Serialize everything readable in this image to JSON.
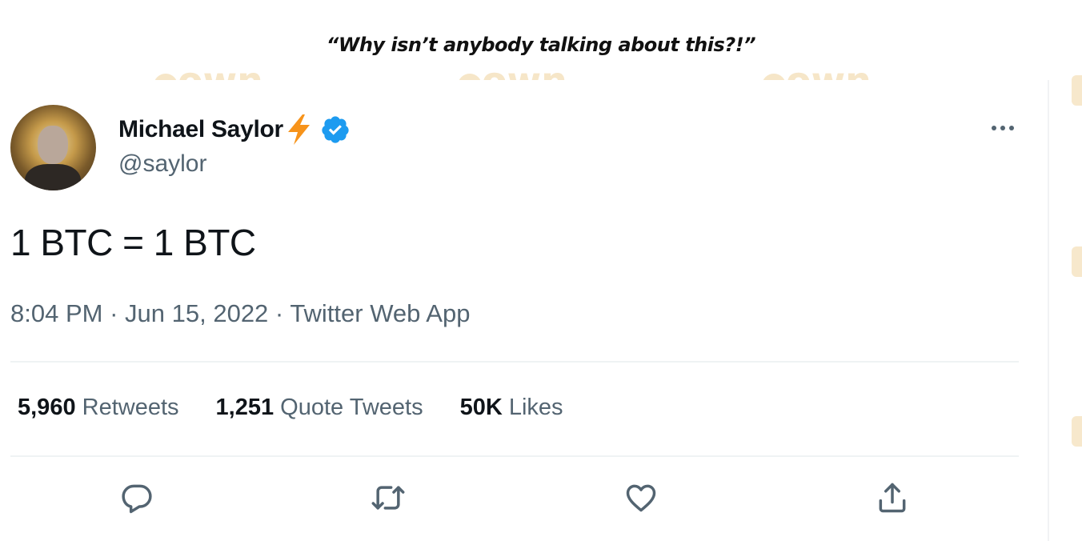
{
  "caption": "“Why isn’t anybody talking about this?!”",
  "watermark": {
    "text": "own",
    "color": "#f6e6c8"
  },
  "tweet": {
    "author_name": "Michael Saylor",
    "author_emoji": "⚡",
    "verified": true,
    "handle": "@saylor",
    "text": "1 BTC = 1 BTC",
    "time": "8:04 PM",
    "date": "Jun 15, 2022",
    "separator": "·",
    "source": "Twitter Web App",
    "stats": [
      {
        "value": "5,960",
        "label": "Retweets"
      },
      {
        "value": "1,251",
        "label": "Quote Tweets"
      },
      {
        "value": "50K",
        "label": "Likes"
      }
    ],
    "actions": [
      "reply-icon",
      "retweet-icon",
      "like-icon",
      "share-icon"
    ],
    "icons": {
      "more": "more-icon",
      "verified": "verified-icon",
      "bolt": "lightning-bolt-icon"
    }
  },
  "colors": {
    "text_primary": "#0f1419",
    "text_secondary": "#536471",
    "verified_blue": "#1d9bf0",
    "bolt_orange": "#f7931a",
    "divider": "#eff3f4"
  }
}
